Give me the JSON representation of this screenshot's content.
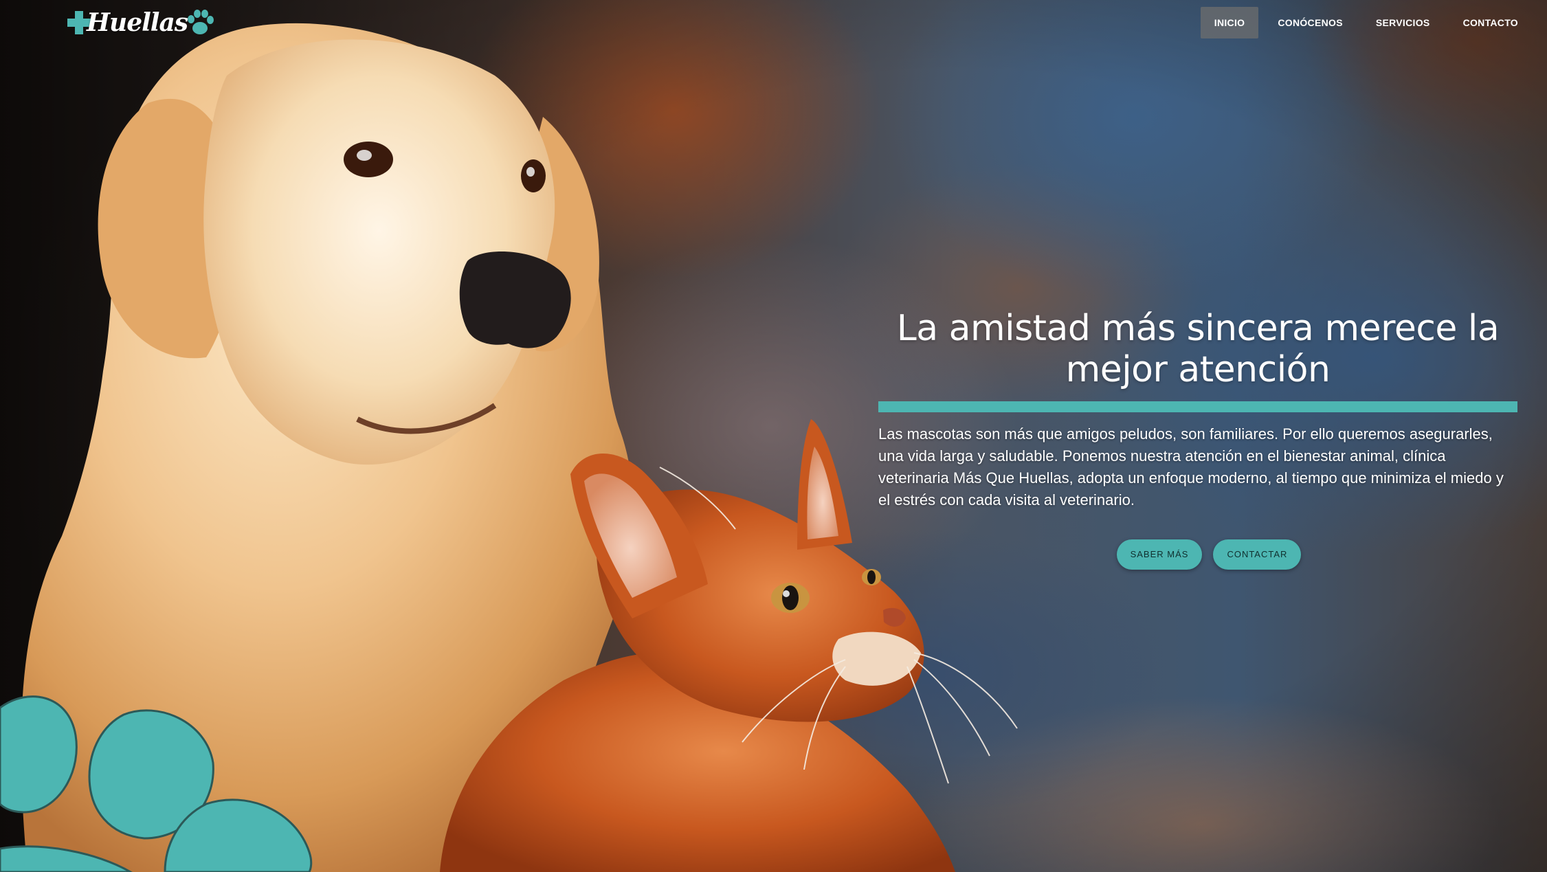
{
  "brand": {
    "logo_text": "Huellas",
    "accent_color": "#4db6b2"
  },
  "nav": {
    "items": [
      {
        "label": "INICIO",
        "active": true
      },
      {
        "label": "CONÓCENOS",
        "active": false
      },
      {
        "label": "SERVICIOS",
        "active": false
      },
      {
        "label": "CONTACTO",
        "active": false
      }
    ]
  },
  "hero": {
    "title": "La amistad más sincera merece la mejor atención",
    "paragraph": "Las mascotas son más que amigos peludos, son familiares. Por ello queremos asegurarles, una vida larga y saludable. Ponemos nuestra atención en el bienestar animal, clínica veterinaria Más Que Huellas, adopta un enfoque moderno, al tiempo que minimiza el miedo y el estrés con cada visita al veterinario.",
    "buttons": {
      "primary": "SABER MÁS",
      "secondary": "CONTACTAR"
    },
    "image_subject": "golden retriever dog and orange kitten",
    "decoration_icon": "paw-print-icon"
  }
}
